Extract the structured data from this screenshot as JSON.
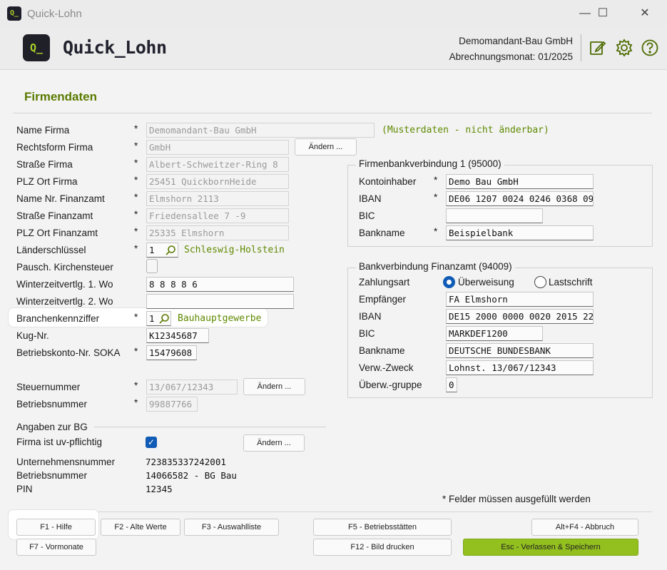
{
  "window": {
    "title": "Quick-Lohn"
  },
  "header": {
    "logo_mark": "Q_",
    "logo_text": "Quick_Lohn",
    "company": "Demomandant-Bau GmbH",
    "month": "Abrechnungsmonat: 01/2025",
    "icons": [
      "edit-icon",
      "gear-icon",
      "help-icon"
    ]
  },
  "section_title": "Firmendaten",
  "required_star": "*",
  "form": {
    "name_firma": {
      "label": "Name Firma",
      "value": "Demomandant-Bau GmbH",
      "note": "(Musterdaten - nicht änderbar)"
    },
    "rechtsform": {
      "label": "Rechtsform Firma",
      "value": "GmbH",
      "button": "Ändern ..."
    },
    "strasse_firma": {
      "label": "Straße Firma",
      "value": "Albert-Schweitzer-Ring 8"
    },
    "plz_ort_firma": {
      "label": "PLZ Ort Firma",
      "value": "25451 QuickbornHeide"
    },
    "finanzamt": {
      "label": "Name Nr. Finanzamt",
      "value": "Elmshorn 2113"
    },
    "strasse_finanzamt": {
      "label": "Straße Finanzamt",
      "value": "Friedensallee 7 -9"
    },
    "plz_ort_finanzamt": {
      "label": "PLZ Ort Finanzamt",
      "value": "25335 Elmshorn"
    },
    "laenderschluessel": {
      "label": "Länderschlüssel",
      "value": "1",
      "text": "Schleswig-Holstein"
    },
    "kirchensteuer": {
      "label": "Pausch. Kirchensteuer",
      "checked": false
    },
    "winter1": {
      "label": "Winterzeitvertlg. 1. Wo",
      "value": "8 8 8 8 6"
    },
    "winter2": {
      "label": "Winterzeitvertlg. 2. Wo",
      "value": ""
    },
    "branche": {
      "label": "Branchenkennziffer",
      "value": "1",
      "text": "Bauhauptgewerbe"
    },
    "kug": {
      "label": "Kug-Nr.",
      "value": "K12345687"
    },
    "soka": {
      "label": "Betriebskonto-Nr. SOKA",
      "value": "15479608"
    },
    "steuernummer": {
      "label": "Steuernummer",
      "value": "13/067/12343",
      "button": "Ändern ..."
    },
    "betriebsnummer": {
      "label": "Betriebsnummer",
      "value": "99887766"
    }
  },
  "bg": {
    "title": "Angaben zur BG",
    "uv_label": "Firma ist uv-pflichtig",
    "uv_checked": true,
    "button": "Ändern ...",
    "rows": [
      {
        "label": "Unternehmensnummer",
        "value": "723835337242001"
      },
      {
        "label": "Betriebsnummer",
        "value": "14066582 - BG Bau"
      },
      {
        "label": "PIN",
        "value": "12345"
      }
    ]
  },
  "bank1": {
    "title": "Firmenbankverbindung 1  (95000)",
    "kontoinhaber": {
      "label": "Kontoinhaber",
      "value": "Demo Bau GmbH"
    },
    "iban": {
      "label": "IBAN",
      "value": "DE06 1207 0024 0246 0368 09"
    },
    "bic": {
      "label": "BIC",
      "value": ""
    },
    "bankname": {
      "label": "Bankname",
      "value": "Beispielbank"
    }
  },
  "bank2": {
    "title": "Bankverbindung Finanzamt (94009)",
    "zahlungsart": {
      "label": "Zahlungsart",
      "option1": "Überweisung",
      "option2": "Lastschrift",
      "selected": "Überweisung"
    },
    "empfaenger": {
      "label": "Empfänger",
      "value": "FA Elmshorn"
    },
    "iban": {
      "label": "IBAN",
      "value": "DE15 2000 0000 0020 2015 22"
    },
    "bic": {
      "label": "BIC",
      "value": "MARKDEF1200"
    },
    "bankname": {
      "label": "Bankname",
      "value": "DEUTSCHE BUNDESBANK"
    },
    "zweck": {
      "label": "Verw.-Zweck",
      "value": "Lohnst. 13/067/12343"
    },
    "gruppe": {
      "label": "Überw.-gruppe",
      "value": "0"
    }
  },
  "required_note": "*  Felder müssen ausgefüllt werden",
  "footer": {
    "f1": "F1 - Hilfe",
    "f2": "F2 - Alte Werte",
    "f3": "F3 - Auswahlliste",
    "f5": "F5 - Betriebsstätten",
    "altf4": "Alt+F4 - Abbruch",
    "f7": "F7 - Vormonate",
    "f12": "F12 - Bild drucken",
    "esc": "Esc - Verlassen & Speichern"
  },
  "colors": {
    "accent": "#5f8a00",
    "primary_button": "#93c01f",
    "checkbox": "#0f5bb5"
  }
}
